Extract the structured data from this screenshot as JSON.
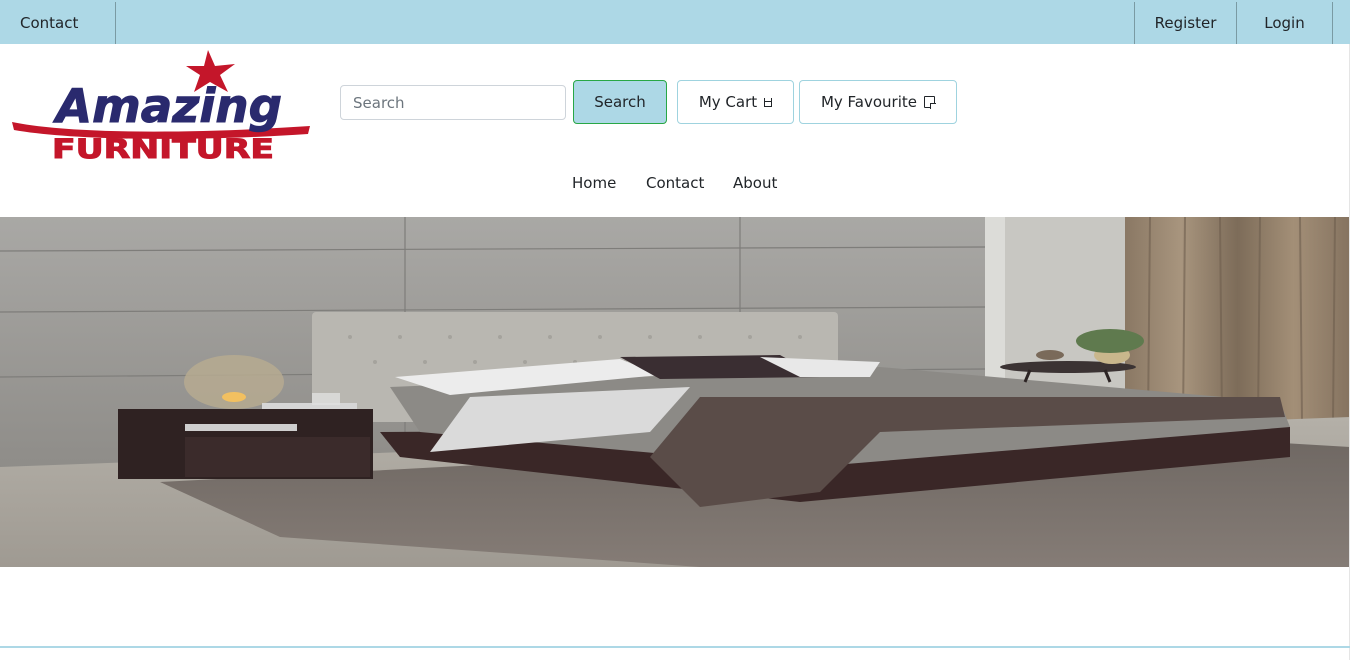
{
  "topbar": {
    "contact": "Contact",
    "register": "Register",
    "login": "Login"
  },
  "logo": {
    "line1": "Amazing",
    "line2": "FURNITURE"
  },
  "search": {
    "placeholder": "Search",
    "button": "Search"
  },
  "buttons": {
    "cart": "My Cart",
    "favourite": "My Favourite"
  },
  "nav": {
    "home": "Home",
    "contact": "Contact",
    "about": "About"
  },
  "colors": {
    "accent": "#add8e6",
    "logo_blue": "#2a2a6e",
    "logo_red": "#c4162a"
  },
  "icons": {
    "cart": "cart-icon",
    "favourite": "note-icon"
  }
}
